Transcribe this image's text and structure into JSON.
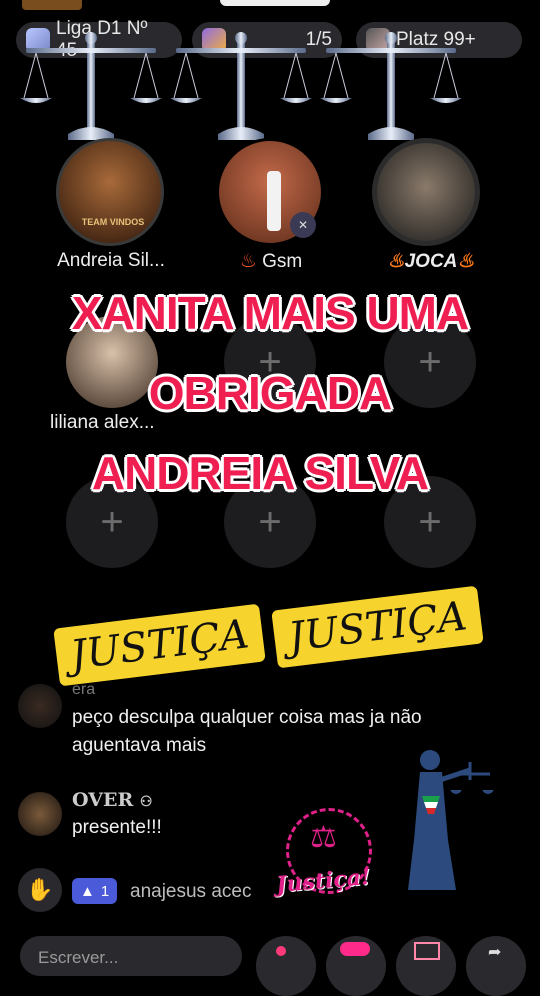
{
  "header": {
    "top_badge": "TEAM VINDOS",
    "league_label": "Liga D1 Nº 45",
    "ranking_label": "1/5",
    "platz_label": "Platz 99+"
  },
  "seats": [
    {
      "name": "Andreia Sil..."
    },
    {
      "name": "Gsm"
    },
    {
      "name": "JOCA"
    }
  ],
  "team_badge": "TEAM VINDOS",
  "row2": {
    "seat1_name": "liliana alex..."
  },
  "banner": {
    "line1": "XANITA MAIS UMA",
    "line2": "OBRIGADA",
    "line3": "ANDREIA SILVA"
  },
  "stickers": {
    "left": "JUSTIÇA",
    "right": "JUSTIÇA",
    "seal": "Justiça!"
  },
  "chat": [
    {
      "user": "era",
      "text": "peço desculpa qualquer coisa mas ja não aguentava mais"
    },
    {
      "user": "OVER",
      "text": "presente!!!"
    },
    {
      "user": "1",
      "text": "anajesus acec"
    }
  ],
  "input": {
    "placeholder": "Escrever..."
  },
  "colors": {
    "banner_red": "#ef1f52",
    "sticker_yellow": "#f6d32d",
    "seal_pink": "#e0218a"
  },
  "plus_glyph": "+"
}
